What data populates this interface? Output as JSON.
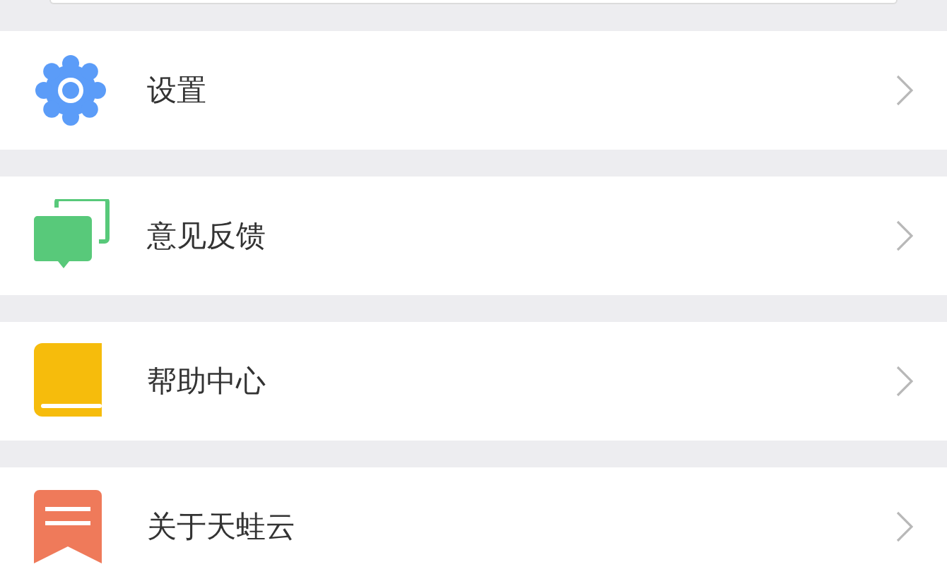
{
  "menu": [
    {
      "kind": "settings",
      "label": "设置"
    },
    {
      "kind": "feedback",
      "label": "意见反馈"
    },
    {
      "kind": "help",
      "label": "帮助中心"
    },
    {
      "kind": "about",
      "label": "关于天蛙云"
    }
  ]
}
